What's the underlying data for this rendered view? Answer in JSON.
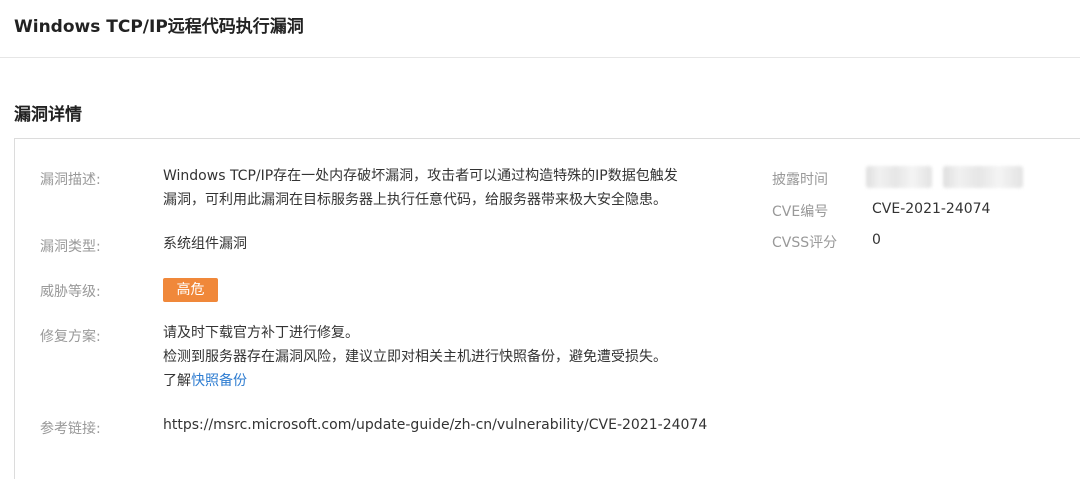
{
  "header": {
    "title": "Windows TCP/IP远程代码执行漏洞"
  },
  "section": {
    "title": "漏洞详情"
  },
  "details": {
    "description": {
      "label": "漏洞描述:",
      "lines": [
        "Windows TCP/IP存在一处内存破坏漏洞，攻击者可以通过构造特殊的IP数据包触发",
        "漏洞，可利用此漏洞在目标服务器上执行任意代码，给服务器带来极大安全隐患。"
      ]
    },
    "type": {
      "label": "漏洞类型:",
      "value": "系统组件漏洞"
    },
    "threat": {
      "label": "威胁等级:",
      "value": "高危",
      "color": "#f0883a"
    },
    "fix": {
      "label": "修复方案:",
      "lines": [
        "请及时下载官方补丁进行修复。",
        "检测到服务器存在漏洞风险，建议立即对相关主机进行快照备份，避免遭受损失。"
      ],
      "learn_prefix": "了解",
      "learn_link": "快照备份"
    },
    "reference": {
      "label": "参考链接:",
      "value": "https://msrc.microsoft.com/update-guide/zh-cn/vulnerability/CVE-2021-24074"
    }
  },
  "side_info": {
    "disclosure": {
      "label": "披露时间"
    },
    "cve": {
      "label": "CVE编号",
      "value": "CVE-2021-24074"
    },
    "cvss": {
      "label": "CVSS评分",
      "value": "0"
    }
  },
  "colors": {
    "label": "#999999",
    "text": "#333333",
    "link": "#2f7dd1",
    "badge": "#f0883a",
    "border": "#dcdcdc"
  }
}
